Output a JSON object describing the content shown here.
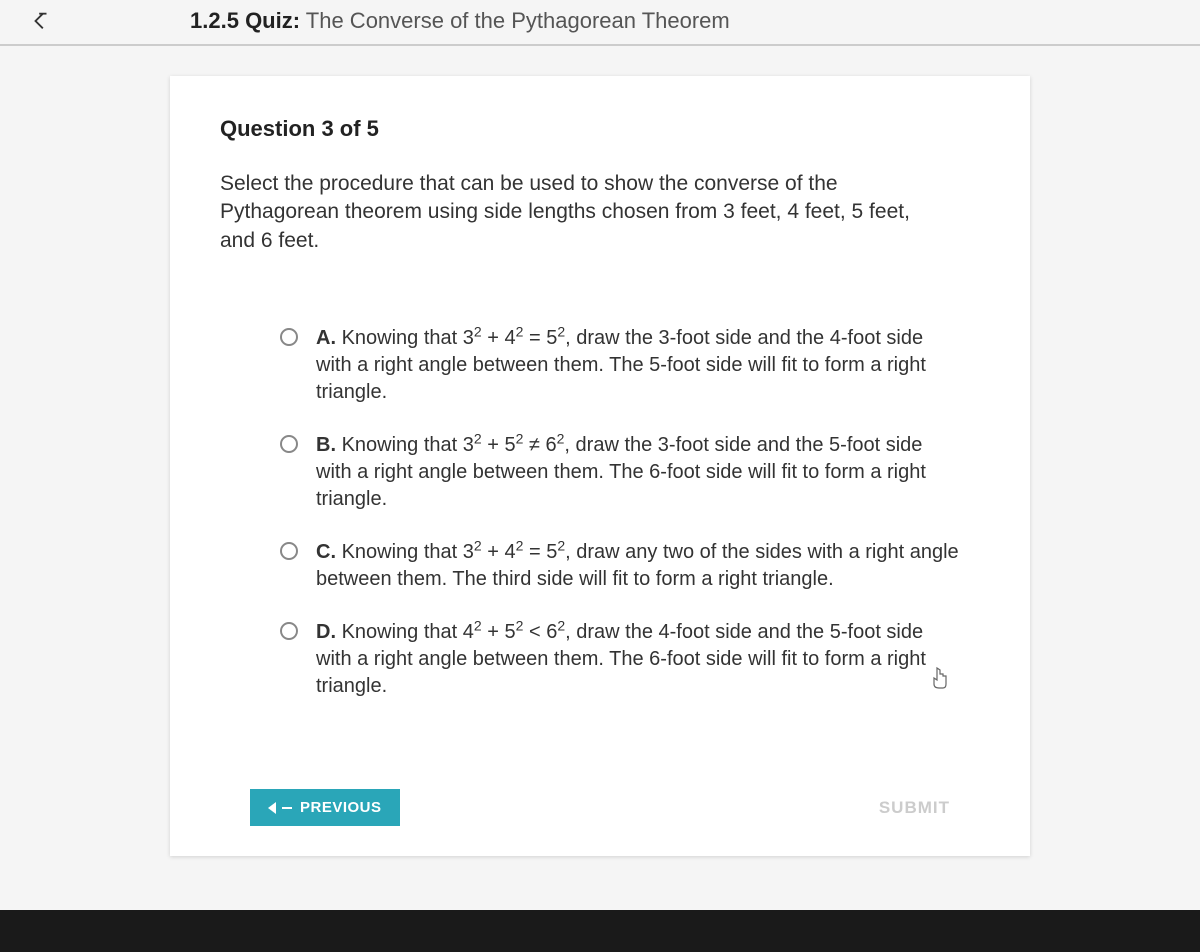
{
  "header": {
    "section_number": "1.2.5",
    "label": "Quiz:",
    "title": "The Converse of the Pythagorean Theorem"
  },
  "question": {
    "heading": "Question 3 of 5",
    "prompt": "Select the procedure that can be used to show the converse of the Pythagorean theorem using side lengths chosen from 3 feet, 4 feet, 5 feet, and 6 feet."
  },
  "options": [
    {
      "letter": "A.",
      "pre": "Knowing that 3",
      "e1": "2",
      "mid1": " + 4",
      "e2": "2",
      "mid2": " = 5",
      "e3": "2",
      "post": ", draw the 3-foot side and the 4-foot side with a right angle between them. The 5-foot side will fit to form a right triangle."
    },
    {
      "letter": "B.",
      "pre": "Knowing that 3",
      "e1": "2",
      "mid1": " + 5",
      "e2": "2",
      "mid2": " ≠ 6",
      "e3": "2",
      "post": ", draw the 3-foot side and the 5-foot side with a right angle between them. The 6-foot side will fit to form a right triangle."
    },
    {
      "letter": "C.",
      "pre": "Knowing that 3",
      "e1": "2",
      "mid1": " + 4",
      "e2": "2",
      "mid2": " = 5",
      "e3": "2",
      "post": ", draw any two of the sides with a right angle between them. The third side will fit to form a right triangle."
    },
    {
      "letter": "D.",
      "pre": "Knowing that 4",
      "e1": "2",
      "mid1": " + 5",
      "e2": "2",
      "mid2": " < 6",
      "e3": "2",
      "post": ", draw the 4-foot side and the 5-foot side with a right angle between them. The 6-foot side will fit to form a right triangle."
    }
  ],
  "buttons": {
    "previous": "PREVIOUS",
    "submit": "SUBMIT"
  }
}
